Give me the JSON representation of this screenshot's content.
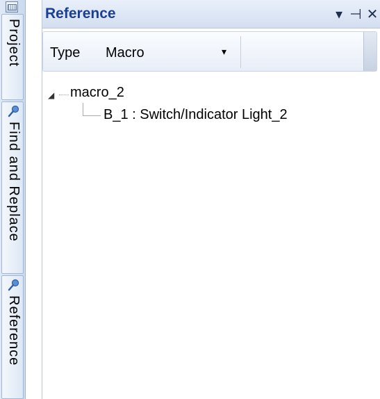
{
  "side_tabs": {
    "project": "Project",
    "find_and_replace": "Find and Replace",
    "reference": "Reference"
  },
  "panel": {
    "title": "Reference",
    "controls": {
      "dropdown_glyph": "▾",
      "pin_glyph": "⊣",
      "close_glyph": "✕"
    }
  },
  "toolbar": {
    "type_label": "Type",
    "type_value": "Macro",
    "type_arrow": "▾"
  },
  "tree": {
    "root": {
      "label": "macro_2",
      "expander": "◢"
    },
    "child": {
      "label": "B_1 : Switch/Indicator Light_2"
    }
  },
  "colors": {
    "title_text": "#1a3f93",
    "accent": "#9fb6d6"
  },
  "icons": {
    "top": "project-grid-icon",
    "find": "magnifier-icon",
    "reference": "magnifier-icon"
  }
}
